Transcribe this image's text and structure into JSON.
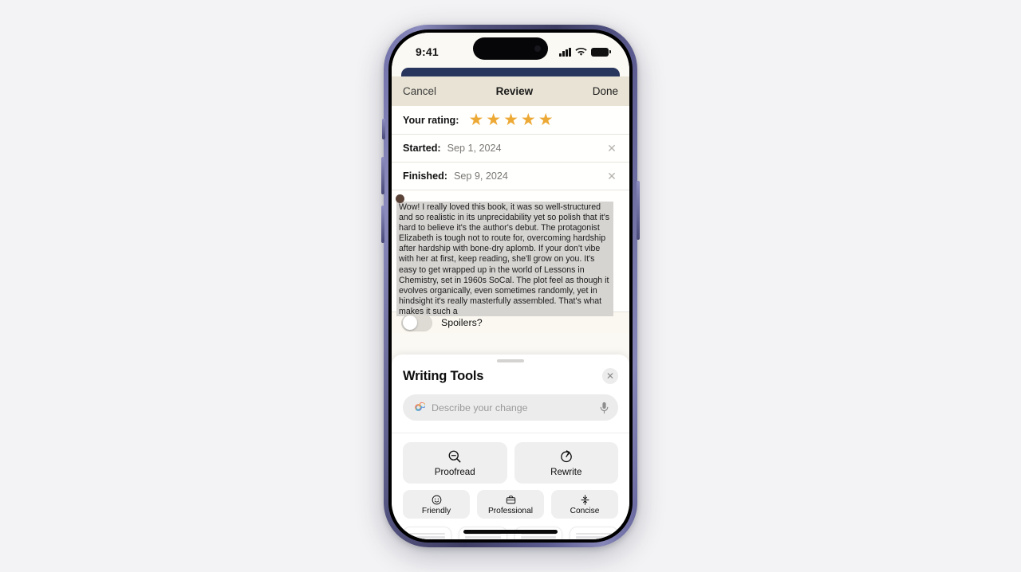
{
  "device": {
    "frame_color": "#4a4a79",
    "status_bar": {
      "time": "9:41",
      "signal_icon": "cellular-bars-icon",
      "wifi_icon": "wifi-icon",
      "battery_icon": "battery-icon"
    }
  },
  "navbar": {
    "cancel_label": "Cancel",
    "title": "Review",
    "done_label": "Done",
    "background": "#e8e3d4"
  },
  "form": {
    "rating": {
      "label": "Your rating:",
      "stars_filled": 5,
      "star_color": "#eda935"
    },
    "started": {
      "label": "Started:",
      "value": "Sep 1, 2024",
      "clear_icon": "close-icon"
    },
    "finished": {
      "label": "Finished:",
      "value": "Sep 9, 2024",
      "clear_icon": "close-icon"
    },
    "review_text": "Wow! I really loved this book, it was so well-structured and so realistic in its unprecidability yet so polish that it's hard to believe it's the author's debut. The protagonist Elizabeth is tough not to route for, overcoming hardship after hardship with bone-dry aplomb. If your don't vibe with her at first, keep reading, she'll grow on you. It's easy to get wrapped up in the world of Lessons in Chemistry, set in 1960s SoCal. The plot feel as though it evolves organically, even sometimes randomly, yet in hindsight it's really masterfully assembled. That's what makes it such a",
    "selection_highlight": "#d6d4d1",
    "spoilers": {
      "label": "Spoilers?",
      "enabled": false
    }
  },
  "writing_tools": {
    "title": "Writing Tools",
    "close_icon": "close-icon",
    "grabber_icon": "drag-handle-icon",
    "field": {
      "placeholder": "Describe your change",
      "value": "",
      "leading_icon": "apple-intelligence-icon",
      "mic_icon": "microphone-icon"
    },
    "primary_actions": [
      {
        "label": "Proofread",
        "icon": "magnifier-minus-icon"
      },
      {
        "label": "Rewrite",
        "icon": "rewrite-circle-arrow-icon"
      }
    ],
    "tone_actions": [
      {
        "label": "Friendly",
        "icon": "smiley-face-icon"
      },
      {
        "label": "Professional",
        "icon": "briefcase-icon"
      },
      {
        "label": "Concise",
        "icon": "compress-vertical-icon"
      }
    ],
    "summary_cards": [
      {
        "icon": "document-card-icon",
        "arrow_icon": "chevron-down-icon"
      },
      {
        "icon": "document-card-icon",
        "arrow_icon": "chevron-down-icon"
      },
      {
        "icon": "document-card-icon",
        "arrow_icon": "chevron-down-icon"
      },
      {
        "icon": "document-card-icon",
        "arrow_icon": "chevron-down-icon"
      }
    ]
  }
}
